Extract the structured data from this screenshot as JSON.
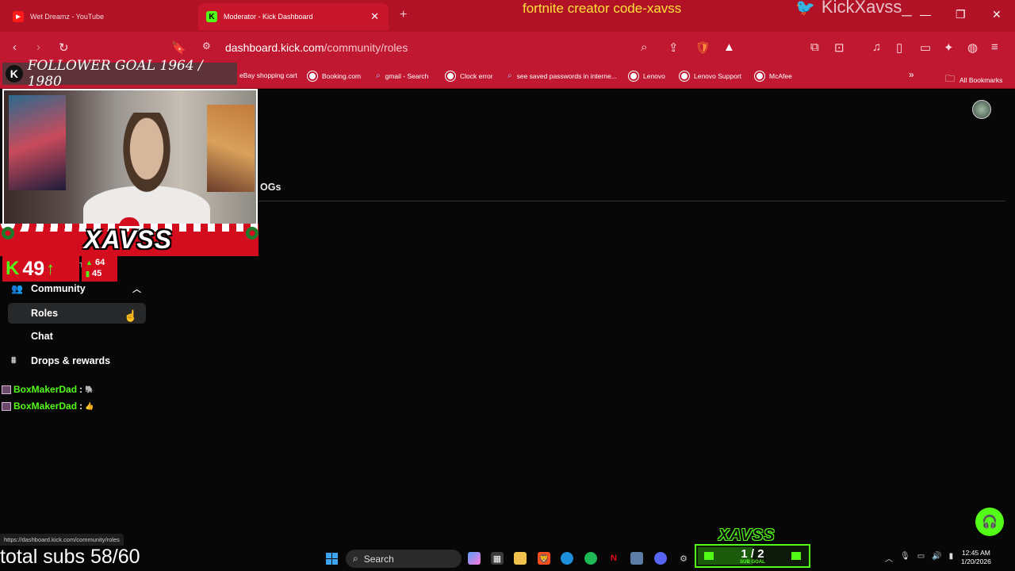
{
  "browser": {
    "tabs": [
      {
        "title": "Wet Dreamz - YouTube",
        "active": false
      },
      {
        "title": "Moderator - Kick Dashboard",
        "active": true
      }
    ],
    "new_tab": "+",
    "url_host": "dashboard.kick.com",
    "url_path": "/community/roles",
    "window_controls": {
      "minimize": "—",
      "restore": "❐",
      "close": "✕"
    },
    "bookmarks": [
      {
        "label": "eBay shopping cart",
        "icon": "ebay-icon"
      },
      {
        "label": "Booking.com",
        "icon": "globe-icon"
      },
      {
        "label": "gmail - Search",
        "icon": "search-icon"
      },
      {
        "label": "Clock error",
        "icon": "globe-icon"
      },
      {
        "label": "see saved passwords in interne...",
        "icon": "search-icon"
      },
      {
        "label": "Lenovo",
        "icon": "globe-icon"
      },
      {
        "label": "Lenovo Support",
        "icon": "globe-icon"
      },
      {
        "label": "McAfee",
        "icon": "globe-icon"
      }
    ],
    "more_bookmarks": "»",
    "all_bookmarks": "All Bookmarks",
    "status_url": "https://dashboard.kick.com/community/roles",
    "theme_color": "#c01830"
  },
  "stream_overlay": {
    "top_text": "fortnite creator code-xavss",
    "twitter_handle": "KickXavss_",
    "follower_goal": "FOLLOWER GOAL 1964 / 1980",
    "streamer_name": "XAVSS",
    "viewer_count": "49",
    "stat_top": "64",
    "stat_bottom": "45",
    "subs_text": "total subs 58/60",
    "sub_goal_value": "1 / 2",
    "sub_goal_label": "SUB GOAL",
    "sub_goal_fraction": 0.5,
    "logo_text": "XAVSS",
    "accent": "#53fc18"
  },
  "dashboard": {
    "tab_label": "OGs",
    "partial_text": "n",
    "sidebar": {
      "community": "Community",
      "roles": "Roles",
      "chat": "Chat",
      "drops": "Drops & rewards"
    },
    "help_icon": "headset-icon"
  },
  "chat": [
    {
      "user": "BoxMakerDad",
      "sep": ":",
      "emote": "🐘"
    },
    {
      "user": "BoxMakerDad",
      "sep": ":",
      "emote": "👍"
    }
  ],
  "taskbar": {
    "search_label": "Search",
    "time": "12:45 AM",
    "date": "1/20/2026"
  }
}
